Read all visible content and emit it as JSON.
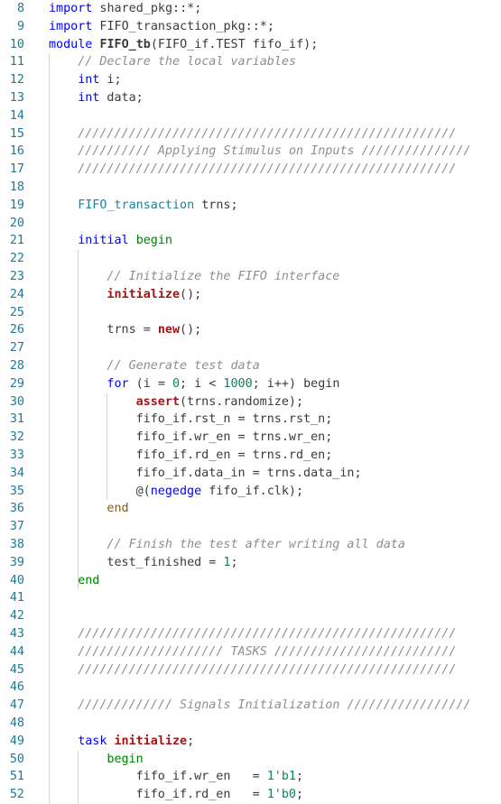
{
  "editor": {
    "lines": [
      {
        "n": "8",
        "indent": 0,
        "tokens": [
          [
            "kw",
            "import"
          ],
          [
            "pl",
            " shared_pkg::*;"
          ]
        ]
      },
      {
        "n": "9",
        "indent": 0,
        "tokens": [
          [
            "kw",
            "import"
          ],
          [
            "pl",
            " FIFO_transaction_pkg::*;"
          ]
        ]
      },
      {
        "n": "10",
        "indent": 0,
        "tokens": [
          [
            "kw",
            "module"
          ],
          [
            "pl",
            " "
          ],
          [
            "bo",
            "FIFO_tb"
          ],
          [
            "pl",
            "(FIFO_if.TEST fifo_if);"
          ]
        ]
      },
      {
        "n": "11",
        "indent": 1,
        "tokens": [
          [
            "cm",
            "// Declare the local variables"
          ]
        ]
      },
      {
        "n": "12",
        "indent": 1,
        "tokens": [
          [
            "kw",
            "int"
          ],
          [
            "pl",
            " i;"
          ]
        ]
      },
      {
        "n": "13",
        "indent": 1,
        "tokens": [
          [
            "kw",
            "int"
          ],
          [
            "pl",
            " data;"
          ]
        ]
      },
      {
        "n": "14",
        "indent": 0,
        "tokens": []
      },
      {
        "n": "15",
        "indent": 1,
        "tokens": [
          [
            "cm",
            "////////////////////////////////////////////////////"
          ]
        ]
      },
      {
        "n": "16",
        "indent": 1,
        "tokens": [
          [
            "cm",
            "////////// Applying Stimulus on Inputs ///////////////"
          ]
        ]
      },
      {
        "n": "17",
        "indent": 1,
        "tokens": [
          [
            "cm",
            "////////////////////////////////////////////////////"
          ]
        ]
      },
      {
        "n": "18",
        "indent": 0,
        "tokens": []
      },
      {
        "n": "19",
        "indent": 1,
        "tokens": [
          [
            "kw2",
            "FIFO_transaction"
          ],
          [
            "pl",
            " trns;"
          ]
        ]
      },
      {
        "n": "20",
        "indent": 0,
        "tokens": []
      },
      {
        "n": "21",
        "indent": 1,
        "tokens": [
          [
            "kw",
            "initial"
          ],
          [
            "pl",
            " "
          ],
          [
            "grn",
            "begin"
          ]
        ]
      },
      {
        "n": "22",
        "indent": 0,
        "tokens": []
      },
      {
        "n": "23",
        "indent": 2,
        "tokens": [
          [
            "cm",
            "// Initialize the FIFO interface"
          ]
        ]
      },
      {
        "n": "24",
        "indent": 2,
        "tokens": [
          [
            "fnb",
            "initialize"
          ],
          [
            "pl",
            "();"
          ]
        ]
      },
      {
        "n": "25",
        "indent": 0,
        "tokens": []
      },
      {
        "n": "26",
        "indent": 2,
        "tokens": [
          [
            "pl",
            "trns = "
          ],
          [
            "fnb",
            "new"
          ],
          [
            "pl",
            "();"
          ]
        ]
      },
      {
        "n": "27",
        "indent": 0,
        "tokens": []
      },
      {
        "n": "28",
        "indent": 2,
        "tokens": [
          [
            "cm",
            "// Generate test data"
          ]
        ]
      },
      {
        "n": "29",
        "indent": 2,
        "tokens": [
          [
            "kw",
            "for"
          ],
          [
            "pl",
            " (i = "
          ],
          [
            "num",
            "0"
          ],
          [
            "pl",
            "; i < "
          ],
          [
            "num",
            "1000"
          ],
          [
            "pl",
            "; i++) begin"
          ]
        ]
      },
      {
        "n": "30",
        "indent": 3,
        "tokens": [
          [
            "fnb",
            "assert"
          ],
          [
            "pl",
            "(trns.randomize);"
          ]
        ]
      },
      {
        "n": "31",
        "indent": 3,
        "tokens": [
          [
            "pl",
            "fifo_if.rst_n = trns.rst_n;"
          ]
        ]
      },
      {
        "n": "32",
        "indent": 3,
        "tokens": [
          [
            "pl",
            "fifo_if.wr_en = trns.wr_en;"
          ]
        ]
      },
      {
        "n": "33",
        "indent": 3,
        "tokens": [
          [
            "pl",
            "fifo_if.rd_en = trns.rd_en;"
          ]
        ]
      },
      {
        "n": "34",
        "indent": 3,
        "tokens": [
          [
            "pl",
            "fifo_if.data_in = trns.data_in;"
          ]
        ]
      },
      {
        "n": "35",
        "indent": 3,
        "tokens": [
          [
            "pl",
            "@("
          ],
          [
            "kw",
            "negedge"
          ],
          [
            "pl",
            " fifo_if.clk);"
          ]
        ]
      },
      {
        "n": "36",
        "indent": 2,
        "tokens": [
          [
            "fn",
            "end"
          ]
        ]
      },
      {
        "n": "37",
        "indent": 0,
        "tokens": []
      },
      {
        "n": "38",
        "indent": 2,
        "tokens": [
          [
            "cm",
            "// Finish the test after writing all data"
          ]
        ]
      },
      {
        "n": "39",
        "indent": 2,
        "tokens": [
          [
            "pl",
            "test_finished = "
          ],
          [
            "num",
            "1"
          ],
          [
            "pl",
            ";"
          ]
        ]
      },
      {
        "n": "40",
        "indent": 1,
        "tokens": [
          [
            "grn",
            "end"
          ]
        ]
      },
      {
        "n": "41",
        "indent": 0,
        "tokens": []
      },
      {
        "n": "42",
        "indent": 0,
        "tokens": []
      },
      {
        "n": "43",
        "indent": 1,
        "tokens": [
          [
            "cm",
            "////////////////////////////////////////////////////"
          ]
        ]
      },
      {
        "n": "44",
        "indent": 1,
        "tokens": [
          [
            "cm",
            "//////////////////// TASKS /////////////////////////"
          ]
        ]
      },
      {
        "n": "45",
        "indent": 1,
        "tokens": [
          [
            "cm",
            "////////////////////////////////////////////////////"
          ]
        ]
      },
      {
        "n": "46",
        "indent": 0,
        "tokens": []
      },
      {
        "n": "47",
        "indent": 1,
        "tokens": [
          [
            "cm",
            "///////////// Signals Initialization /////////////////"
          ]
        ]
      },
      {
        "n": "48",
        "indent": 0,
        "tokens": []
      },
      {
        "n": "49",
        "indent": 1,
        "tokens": [
          [
            "kw",
            "task"
          ],
          [
            "pl",
            " "
          ],
          [
            "fnb",
            "initialize"
          ],
          [
            "pl",
            ";"
          ]
        ]
      },
      {
        "n": "50",
        "indent": 2,
        "tokens": [
          [
            "grn",
            "begin"
          ]
        ]
      },
      {
        "n": "51",
        "indent": 3,
        "tokens": [
          [
            "pl",
            "fifo_if.wr_en   = "
          ],
          [
            "num",
            "1'b1"
          ],
          [
            "pl",
            ";"
          ]
        ]
      },
      {
        "n": "52",
        "indent": 3,
        "tokens": [
          [
            "pl",
            "fifo_if.rd_en   = "
          ],
          [
            "num",
            "1'b0"
          ],
          [
            "pl",
            ";"
          ]
        ]
      }
    ]
  }
}
